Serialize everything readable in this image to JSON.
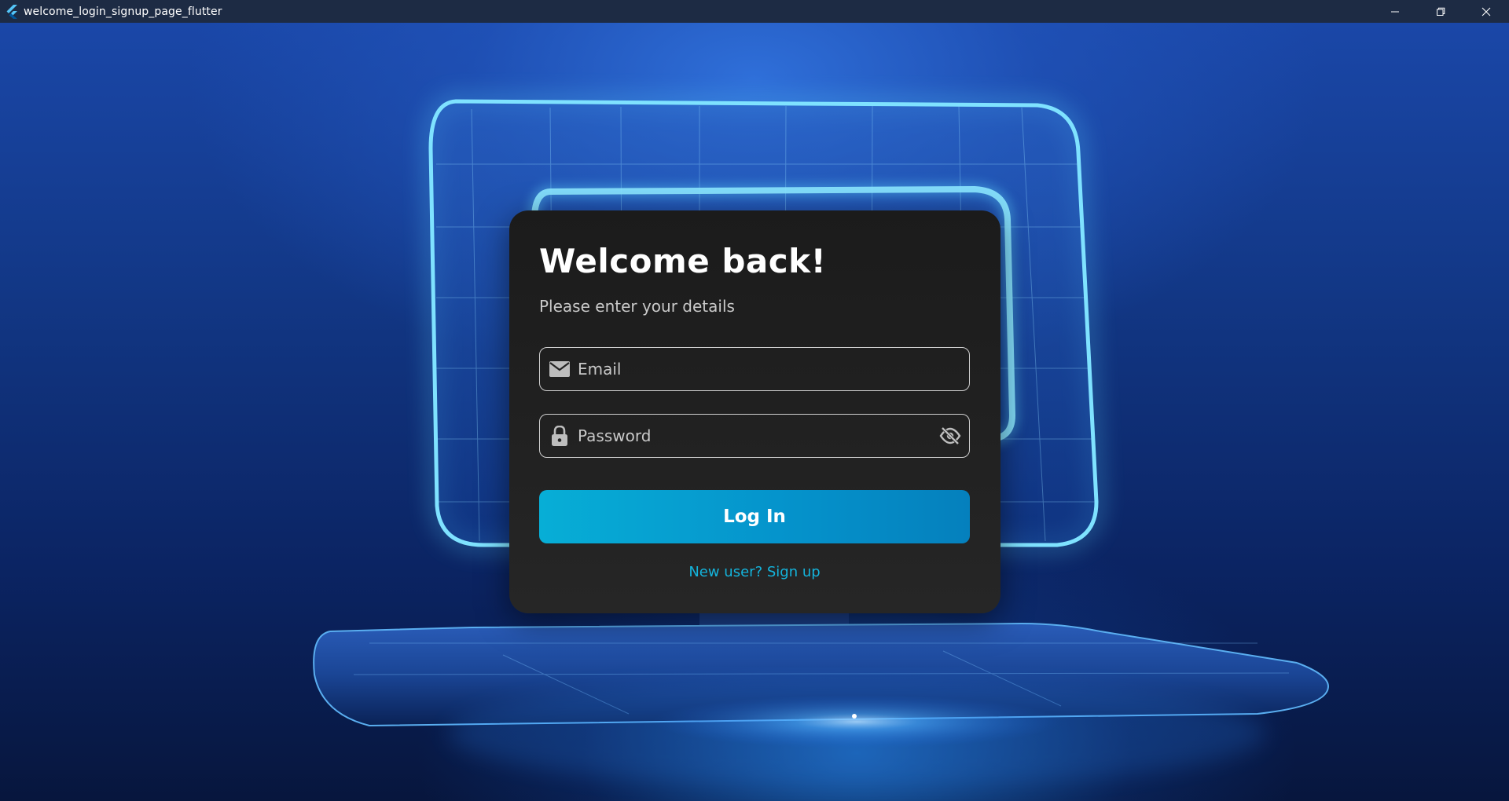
{
  "window": {
    "title": "welcome_login_signup_page_flutter",
    "app_icon": "flutter-logo-icon",
    "controls": [
      "minimize-icon",
      "restore-icon",
      "close-icon"
    ]
  },
  "card": {
    "title": "Welcome back!",
    "subtitle": "Please enter your details",
    "email": {
      "placeholder": "Email",
      "value": "",
      "icon": "mail-icon"
    },
    "password": {
      "placeholder": "Password",
      "value": "",
      "icon": "lock-icon",
      "visibility_icon": "eye-off-icon"
    },
    "login_label": "Log In",
    "signup_label": "New user? Sign up"
  },
  "colors": {
    "accent": "#0594cc",
    "link": "#14b4dc",
    "card_bg": "#1b1b1b",
    "titlebar_bg": "#1d2b44"
  }
}
